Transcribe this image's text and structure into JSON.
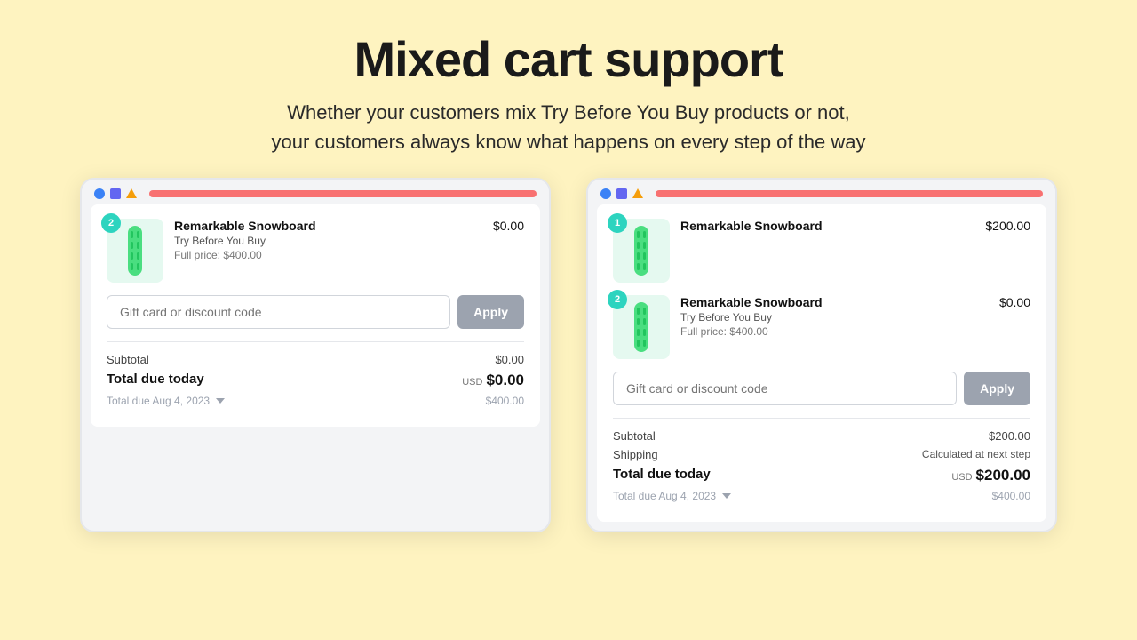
{
  "hero": {
    "title": "Mixed cart support",
    "subtitle_line1": "Whether your customers mix Try Before You Buy products or not,",
    "subtitle_line2": "your customers always know what happens on every step of the way"
  },
  "card_left": {
    "item": {
      "badge": "2",
      "name": "Remarkable Snowboard",
      "tag": "Try Before You Buy",
      "full_price": "Full price: $400.00",
      "price": "$0.00"
    },
    "discount_placeholder": "Gift card or discount code",
    "apply_label": "Apply",
    "subtotal_label": "Subtotal",
    "subtotal_value": "$0.00",
    "total_today_label": "Total due today",
    "total_today_usd": "USD",
    "total_today_value": "$0.00",
    "total_later_label": "Total due Aug 4, 2023",
    "total_later_value": "$400.00"
  },
  "card_right": {
    "item1": {
      "badge": "1",
      "name": "Remarkable Snowboard",
      "price": "$200.00"
    },
    "item2": {
      "badge": "2",
      "name": "Remarkable Snowboard",
      "tag": "Try Before You Buy",
      "full_price": "Full price: $400.00",
      "price": "$0.00"
    },
    "discount_placeholder": "Gift card or discount code",
    "apply_label": "Apply",
    "subtotal_label": "Subtotal",
    "subtotal_value": "$200.00",
    "shipping_label": "Shipping",
    "shipping_value": "Calculated at next step",
    "total_today_label": "Total due today",
    "total_today_usd": "USD",
    "total_today_value": "$200.00",
    "total_later_label": "Total due Aug 4, 2023",
    "total_later_value": "$400.00"
  },
  "colors": {
    "background": "#fef3c0",
    "accent": "#f87171",
    "teal_badge": "#2dd4bf"
  }
}
